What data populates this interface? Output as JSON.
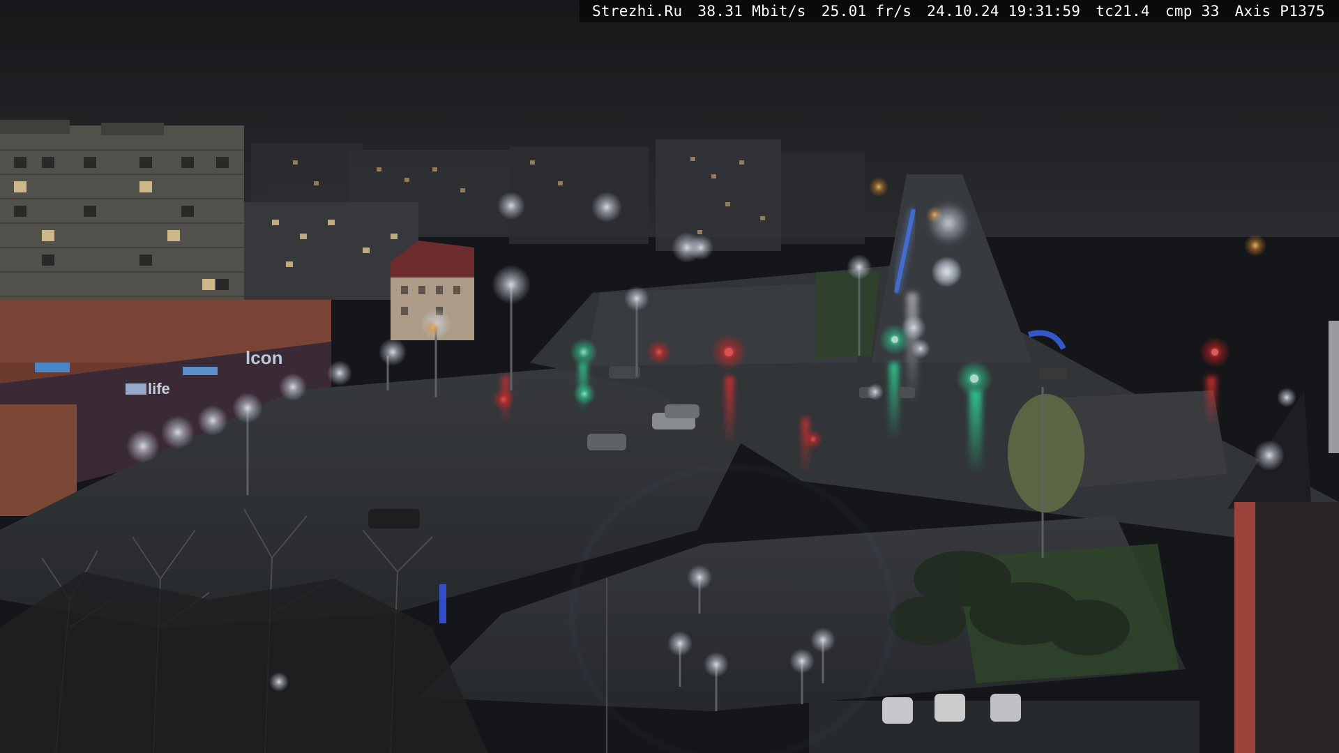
{
  "overlay": {
    "site": "Strezhi.Ru",
    "bitrate": "38.31 Mbit/s",
    "framerate": "25.01 fr/s",
    "timestamp": "24.10.24 19:31:59",
    "temperature": "tc21.4",
    "compression": "cmp 33",
    "camera": "Axis P1375"
  },
  "scene": {
    "signs": {
      "left_store": "lcon",
      "left_store_2": "life"
    }
  },
  "colors": {
    "sky": "#1a1c1f",
    "road_wet": "#2c3033",
    "grass": "#2f4a28",
    "sign_blue": "#4da3ff",
    "traffic_red": "#ff2a2a",
    "traffic_green": "#2dffb0",
    "street_light": "#f4f8ff"
  }
}
